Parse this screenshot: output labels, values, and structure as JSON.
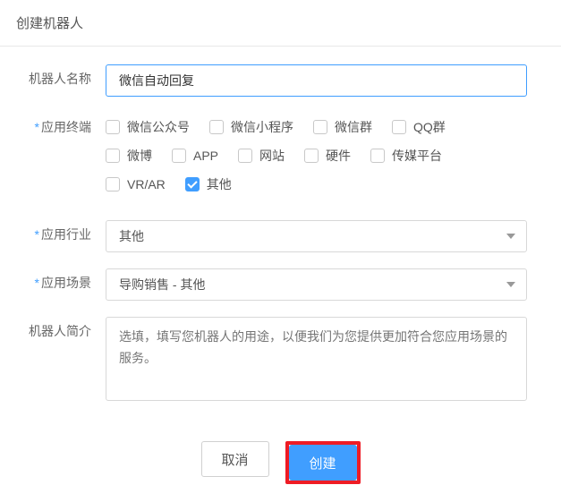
{
  "dialog": {
    "title": "创建机器人"
  },
  "form": {
    "name_label": "机器人名称",
    "name_value": "微信自动回复",
    "terminal_label": "应用终端",
    "terminals": [
      {
        "label": "微信公众号",
        "checked": false
      },
      {
        "label": "微信小程序",
        "checked": false
      },
      {
        "label": "微信群",
        "checked": false
      },
      {
        "label": "QQ群",
        "checked": false
      },
      {
        "label": "微博",
        "checked": false
      },
      {
        "label": "APP",
        "checked": false
      },
      {
        "label": "网站",
        "checked": false
      },
      {
        "label": "硬件",
        "checked": false
      },
      {
        "label": "传媒平台",
        "checked": false
      },
      {
        "label": "VR/AR",
        "checked": false
      },
      {
        "label": "其他",
        "checked": true
      }
    ],
    "industry_label": "应用行业",
    "industry_value": "其他",
    "scenario_label": "应用场景",
    "scenario_value": "导购销售 - 其他",
    "desc_label": "机器人简介",
    "desc_placeholder": "选填，填写您机器人的用途，以便我们为您提供更加符合您应用场景的服务。"
  },
  "actions": {
    "cancel": "取消",
    "create": "创建"
  }
}
